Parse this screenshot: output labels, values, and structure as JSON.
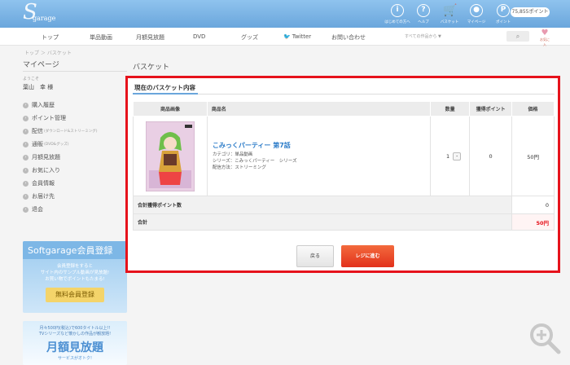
{
  "header": {
    "logo_main": "S",
    "logo_sub": "garage",
    "icons": [
      {
        "icon": "info-icon",
        "glyph": "i",
        "label": "はじめての方へ"
      },
      {
        "icon": "help-icon",
        "glyph": "?",
        "label": "ヘルプ"
      },
      {
        "icon": "cart-icon",
        "glyph": "🛒",
        "label": "バスケット"
      },
      {
        "icon": "user-icon",
        "glyph": "●",
        "label": "マイページ"
      },
      {
        "icon": "points-icon",
        "glyph": "P",
        "label": "ポイント"
      }
    ],
    "points_value": "75,855ポイント"
  },
  "nav": {
    "items": [
      "トップ",
      "単品動画",
      "月額見放題",
      "DVD",
      "グッズ",
      "Twitter",
      "お問い合わせ"
    ],
    "search_placeholder": "すべての作品から ▼",
    "search_glyph": "⌕",
    "fav_glyph": "♥",
    "fav_label": "お気に入"
  },
  "breadcrumb": "トップ ＞ バスケット",
  "sidebar": {
    "title": "マイページ",
    "welcome": "ようこそ",
    "user_name": "葉山　幸 様",
    "items": [
      {
        "label": "購入履歴",
        "note": ""
      },
      {
        "label": "ポイント管理",
        "note": ""
      },
      {
        "label": "配信",
        "note": "(ダウンロード&ストリーミング)"
      },
      {
        "label": "通販",
        "note": "(DVD&グッズ)"
      },
      {
        "label": "月額見放題",
        "note": ""
      },
      {
        "label": "お気に入り",
        "note": ""
      },
      {
        "label": "会員情報",
        "note": ""
      },
      {
        "label": "お届け先",
        "note": ""
      },
      {
        "label": "退会",
        "note": ""
      }
    ],
    "bullet_glyph": "›",
    "banner_member": {
      "title": "Softgarage会員登録",
      "line1": "会員登録をすると",
      "line2": "サイト内のサンプル動画が見放題!",
      "line3": "お買い物でポイントもたまる!",
      "button": "無料会員登録"
    },
    "banner_monthly": {
      "line1": "月々500円(税込)で600タイトル以上!!",
      "line2": "TVシリーズなど懐かしの作品が観放題!",
      "title": "月額見放題",
      "sub": "サービスがオトク!"
    }
  },
  "main": {
    "page_title": "バスケット",
    "panel_title": "現在のバスケット内容",
    "columns": [
      "商品画像",
      "商品名",
      "数量",
      "獲得ポイント",
      "価格"
    ],
    "item": {
      "title": "こみっくパーティー 第7話",
      "category": "カテゴリ：単品動画",
      "series": "シリーズ：こみっくパーティー　シリーズ",
      "delivery": "配信方法：ストリーミング",
      "quantity": "1",
      "qty_button": "-",
      "points": "0",
      "price": "50円"
    },
    "points_total_label": "合計獲得ポイント数",
    "points_total_value": "0",
    "total_label": "合計",
    "total_value": "50円",
    "back_button": "戻る",
    "checkout_button": "レジに進む"
  },
  "colors": {
    "accent_red": "#e6121b",
    "header_blue": "#6aa6dc",
    "link_blue": "#2b7bc8"
  }
}
